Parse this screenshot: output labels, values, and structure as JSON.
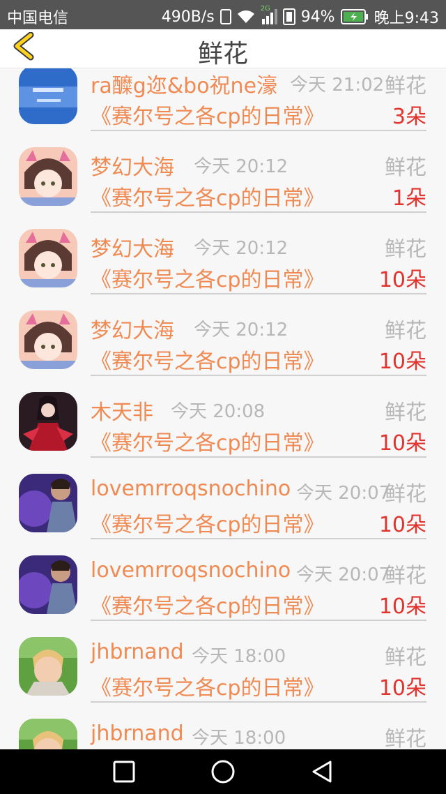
{
  "status": {
    "carrier": "中国电信",
    "speed": "490B/s",
    "network": "2G",
    "battery": "94%",
    "time": "晚上9:43"
  },
  "header": {
    "title": "鲜花"
  },
  "rows": [
    {
      "name": "ra醾g迩&bo祝ne濠",
      "time": "今天 21:02",
      "flower": "鲜花",
      "story": "《赛尔号之各cp的日常》",
      "count": "3朵",
      "avatar": "sky-avatar"
    },
    {
      "name": "梦幻大海",
      "time": "今天 20:12",
      "flower": "鲜花",
      "story": "《赛尔号之各cp的日常》",
      "count": "1朵",
      "avatar": "cat-girl-avatar"
    },
    {
      "name": "梦幻大海",
      "time": "今天 20:12",
      "flower": "鲜花",
      "story": "《赛尔号之各cp的日常》",
      "count": "10朵",
      "avatar": "cat-girl-avatar"
    },
    {
      "name": "梦幻大海",
      "time": "今天 20:12",
      "flower": "鲜花",
      "story": "《赛尔号之各cp的日常》",
      "count": "10朵",
      "avatar": "cat-girl-avatar"
    },
    {
      "name": "木天非",
      "time": "今天 20:08",
      "flower": "鲜花",
      "story": "《赛尔号之各cp的日常》",
      "count": "10朵",
      "avatar": "red-anime-avatar"
    },
    {
      "name": "lovemrroqsnochino",
      "time": "今天 20:07",
      "flower": "鲜花",
      "story": "《赛尔号之各cp的日常》",
      "count": "10朵",
      "avatar": "purple-boy-avatar"
    },
    {
      "name": "lovemrroqsnochino",
      "time": "今天 20:07",
      "flower": "鲜花",
      "story": "《赛尔号之各cp的日常》",
      "count": "10朵",
      "avatar": "purple-boy-avatar"
    },
    {
      "name": "jhbrnand",
      "time": "今天 18:00",
      "flower": "鲜花",
      "story": "《赛尔号之各cp的日常》",
      "count": "10朵",
      "avatar": "child-photo-avatar"
    },
    {
      "name": "jhbrnand",
      "time": "今天 18:00",
      "flower": "鲜花",
      "story": "",
      "count": "",
      "avatar": "child-photo-avatar"
    }
  ],
  "colors": {
    "name": "#f08a53",
    "count": "#e2342f",
    "muted": "#b7b7b7"
  }
}
